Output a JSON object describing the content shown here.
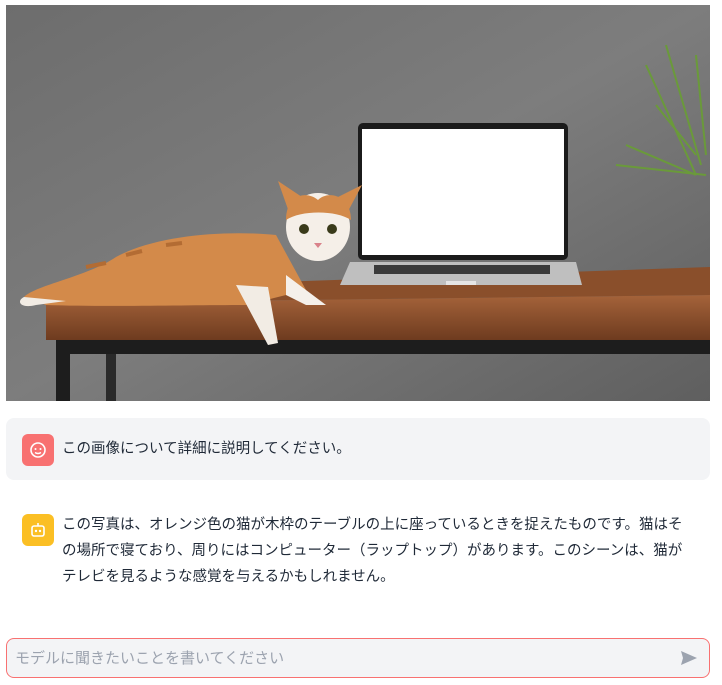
{
  "image": {
    "alt_icon": "cat-on-desk-with-laptop-photo"
  },
  "conversation": [
    {
      "role": "user",
      "avatar_icon": "user-face-icon",
      "text": "この画像について詳細に説明してください。"
    },
    {
      "role": "assistant",
      "avatar_icon": "robot-icon",
      "text": "この写真は、オレンジ色の猫が木枠のテーブルの上に座っているときを捉えたものです。猫はその場所で寝ており、周りにはコンピューター（ラップトップ）があります。このシーンは、猫がテレビを見るような感覚を与えるかもしれません。"
    }
  ],
  "input": {
    "placeholder": "モデルに聞きたいことを書いてください",
    "value": ""
  },
  "send_icon": "send-icon",
  "colors": {
    "user_avatar": "#f87171",
    "assistant_avatar": "#fbbf24",
    "input_border": "#f87171",
    "bubble_bg": "#f3f4f6"
  }
}
